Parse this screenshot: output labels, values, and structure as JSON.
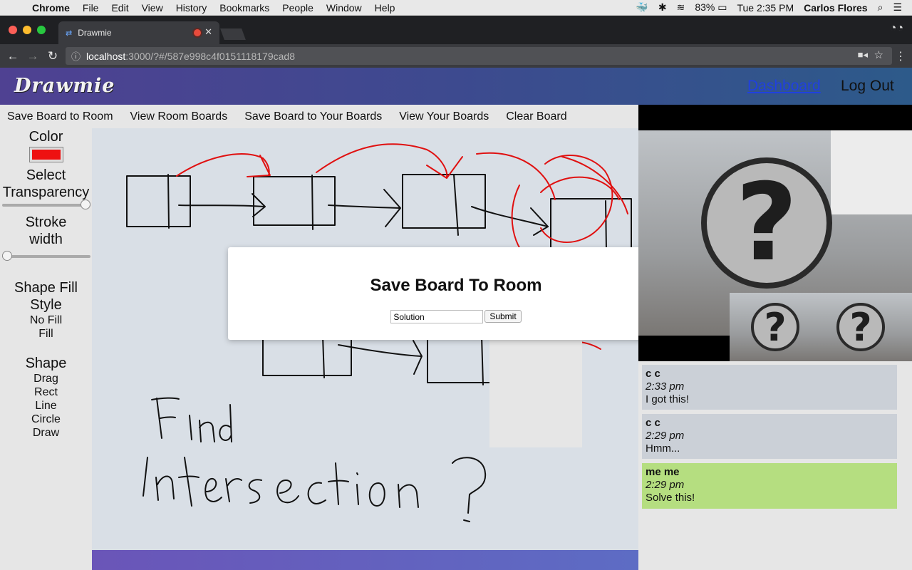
{
  "menubar": {
    "app": "Chrome",
    "items": [
      "File",
      "Edit",
      "View",
      "History",
      "Bookmarks",
      "People",
      "Window",
      "Help"
    ],
    "battery": "83%",
    "clock": "Tue 2:35 PM",
    "user": "Carlos Flores"
  },
  "browser": {
    "tab_title": "Drawmie",
    "url_host": "localhost",
    "url_path": ":3000/?#/587e998c4f0151118179cad8"
  },
  "header": {
    "logo": "Drawmie",
    "dashboard": "Dashboard",
    "logout": "Log Out"
  },
  "boardbar": {
    "save_room": "Save Board to Room",
    "view_room": "View Room Boards",
    "save_yours": "Save Board to Your Boards",
    "view_yours": "View Your Boards",
    "clear": "Clear Board"
  },
  "tools": {
    "color_title": "Color",
    "color_value": "#ee1111",
    "transparency_title_1": "Select",
    "transparency_title_2": "Transparency",
    "transparency_level": 1.0,
    "stroke_title_1": "Stroke",
    "stroke_title_2": "width",
    "stroke_level": 0.0,
    "fill_title_1": "Shape Fill",
    "fill_title_2": "Style",
    "fill_options": [
      "No Fill",
      "Fill"
    ],
    "shape_title": "Shape",
    "shape_options": [
      "Drag",
      "Rect",
      "Line",
      "Circle",
      "Draw"
    ]
  },
  "modal": {
    "title": "Save Board To Room",
    "input_value": "Solution",
    "submit": "Submit"
  },
  "chat": [
    {
      "author": "c c",
      "time": "2:33 pm",
      "text": "I got this!",
      "mine": false
    },
    {
      "author": "c c",
      "time": "2:29 pm",
      "text": "Hmm...",
      "mine": false
    },
    {
      "author": "me me",
      "time": "2:29 pm",
      "text": "Solve this!",
      "mine": true
    }
  ],
  "icons": {
    "apple": "apple-icon",
    "back": "back-arrow-icon",
    "forward": "forward-arrow-icon",
    "reload": "reload-icon",
    "info": "info-icon",
    "camera": "camera-icon",
    "star": "star-icon",
    "search": "search-icon",
    "menu": "menu-list-icon"
  }
}
